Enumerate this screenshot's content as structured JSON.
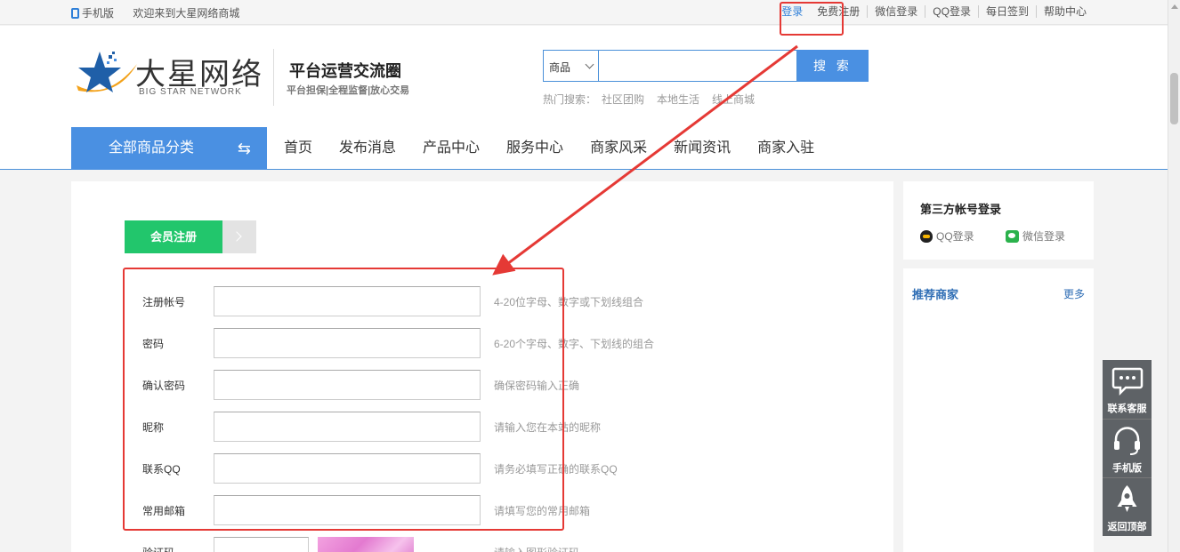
{
  "topbar": {
    "mobile": "手机版",
    "welcome": "欢迎来到大星网络商城",
    "links": [
      "登录",
      "免费注册",
      "微信登录",
      "QQ登录",
      "每日签到",
      "帮助中心"
    ]
  },
  "logo": {
    "name": "大星网络",
    "en": "BIG STAR NETWORK",
    "slogan": "平台运营交流圈",
    "slogan_sub": "平台担保|全程监督|放心交易"
  },
  "search": {
    "category": "商品",
    "placeholder": "",
    "button": "搜 索",
    "hot_label": "热门搜索：",
    "hot": [
      "社区团购",
      "本地生活",
      "线上商城"
    ]
  },
  "nav": {
    "all_categories": "全部商品分类",
    "items": [
      "首页",
      "发布消息",
      "产品中心",
      "服务中心",
      "商家风采",
      "新闻资讯",
      "商家入驻"
    ]
  },
  "register": {
    "tab": "会员注册",
    "fields": [
      {
        "label": "注册帐号",
        "tip": "4-20位字母、数字或下划线组合"
      },
      {
        "label": "密码",
        "tip": "6-20个字母、数字、下划线的组合"
      },
      {
        "label": "确认密码",
        "tip": "确保密码输入正确"
      },
      {
        "label": "昵称",
        "tip": "请输入您在本站的昵称"
      },
      {
        "label": "联系QQ",
        "tip": "请务必填写正确的联系QQ"
      },
      {
        "label": "常用邮箱",
        "tip": "请填写您的常用邮箱"
      },
      {
        "label": "验证码",
        "tip": "请输入图形验证码"
      }
    ]
  },
  "sidebar": {
    "third_party_title": "第三方帐号登录",
    "qq_login": "QQ登录",
    "wechat_login": "微信登录",
    "recommend_title": "推荐商家",
    "more": "更多"
  },
  "floating": [
    "联系客服",
    "手机版",
    "返回顶部"
  ],
  "colors": {
    "accent": "#4a90e2",
    "green_tab": "#22c66c",
    "annotation_red": "#e53935",
    "link_blue": "#2f6eb5"
  }
}
